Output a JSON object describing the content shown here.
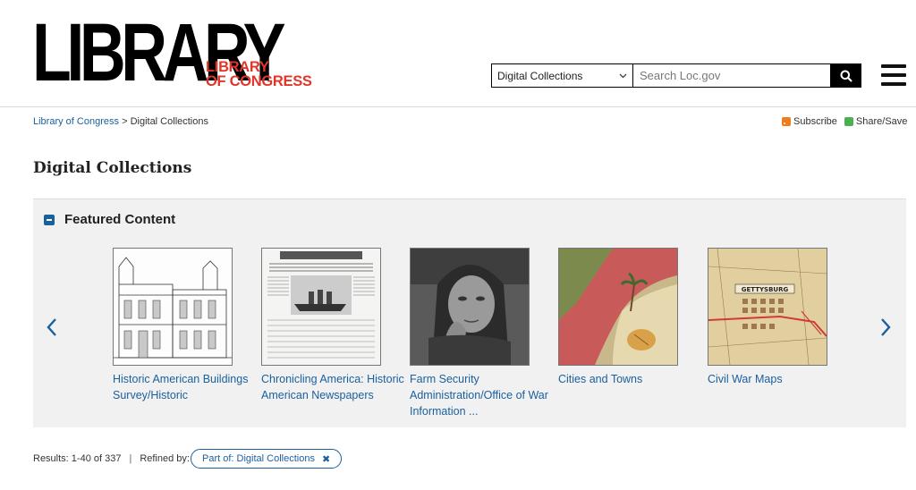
{
  "header": {
    "logo_main": "LIBRARY",
    "logo_red_line1": "LIBRARY",
    "logo_red_line2": "OF CONGRESS",
    "search_scope": "Digital Collections",
    "search_placeholder": "Search Loc.gov"
  },
  "breadcrumb": {
    "home": "Library of Congress",
    "separator": ">",
    "current": "Digital Collections"
  },
  "share": {
    "subscribe": "Subscribe",
    "share_save": "Share/Save"
  },
  "page_title": "Digital Collections",
  "featured": {
    "title": "Featured Content",
    "cards": [
      {
        "label": "Historic American Buildings Survey/Historic",
        "icon": "building-drawing"
      },
      {
        "label": "Chronicling America: Historic American Newspapers",
        "icon": "newspaper"
      },
      {
        "label": "Farm Security Administration/Office of War Information ...",
        "icon": "portrait-photo"
      },
      {
        "label": "Cities and Towns",
        "icon": "colored-map"
      },
      {
        "label": "Civil War Maps",
        "icon": "gettysburg-map"
      }
    ]
  },
  "results": {
    "summary": "Results: 1-40 of 337",
    "separator": "|",
    "refined_by": "Refined by:",
    "filter_chip": "Part of: Digital Collections"
  },
  "colors": {
    "link": "#1a5f9e",
    "brand_red": "#e0362a",
    "panel_bg": "#f1f1f1"
  }
}
